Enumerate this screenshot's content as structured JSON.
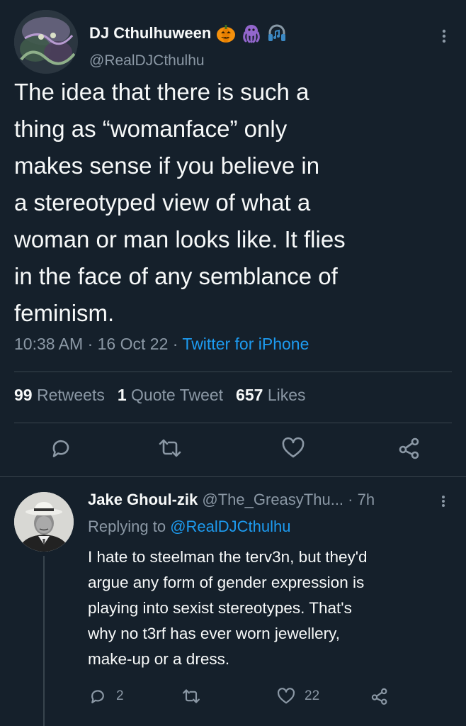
{
  "main_tweet": {
    "display_name": "DJ Cthulhuween",
    "name_emojis": [
      "pumpkin-emoji",
      "octopus-emoji",
      "headphones-emoji"
    ],
    "handle": "@RealDJCthulhu",
    "text": "The idea that there is such a\nthing as “womanface” only\nmakes sense if you believe in\na stereotyped view of what a\nwoman or man looks like.  It flies\nin the face of any semblance of\nfeminism.",
    "time": "10:38 AM",
    "date": "16 Oct 22",
    "source": "Twitter for iPhone",
    "separator": "·",
    "stats": {
      "retweets_count": "99",
      "retweets_label": "Retweets",
      "quotes_count": "1",
      "quotes_label": "Quote Tweet",
      "likes_count": "657",
      "likes_label": "Likes"
    },
    "actions": [
      "reply-icon",
      "retweet-icon",
      "like-icon",
      "share-icon"
    ]
  },
  "reply": {
    "display_name": "Jake Ghoul-zik",
    "handle": "@The_GreasyThu...",
    "separator": "·",
    "age": "7h",
    "replying_to_label": "Replying to",
    "replying_to_handle": "@RealDJCthulhu",
    "text": "I hate to steelman the terv3n, but they'd\nargue any form of gender expression is\nplaying into sexist stereotypes. That's\nwhy no t3rf has ever worn jewellery,\nmake-up or a dress.",
    "reply_count": "2",
    "like_count": "22"
  },
  "colors": {
    "background": "#15202b",
    "text": "#f7f9f9",
    "secondary": "#8b98a5",
    "accent": "#1d9bf0",
    "divider": "#38444d"
  }
}
